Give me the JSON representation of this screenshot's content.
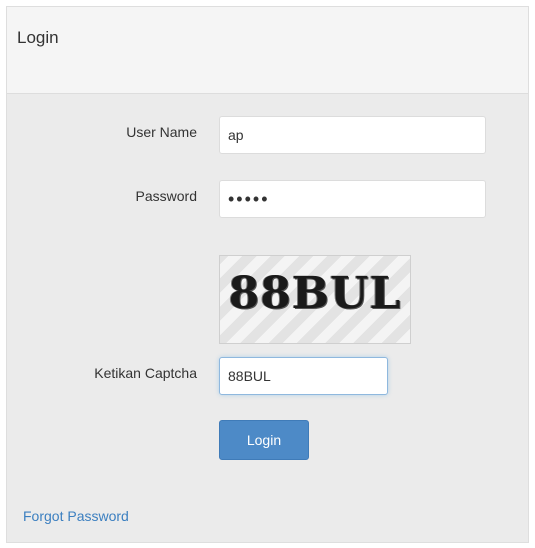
{
  "panel": {
    "title": "Login"
  },
  "form": {
    "username": {
      "label": "User Name",
      "value": "ap"
    },
    "password": {
      "label": "Password",
      "masked_value": "•••••"
    },
    "captcha": {
      "image_text": "88BUL",
      "label": "Ketikan Captcha",
      "value": "88BUL"
    },
    "submit_label": "Login"
  },
  "links": {
    "forgot_password": "Forgot Password"
  },
  "colors": {
    "primary_button": "#4d8ac7",
    "link": "#3b7fc0",
    "panel_background": "#ebebeb",
    "header_background": "#f5f5f5"
  }
}
